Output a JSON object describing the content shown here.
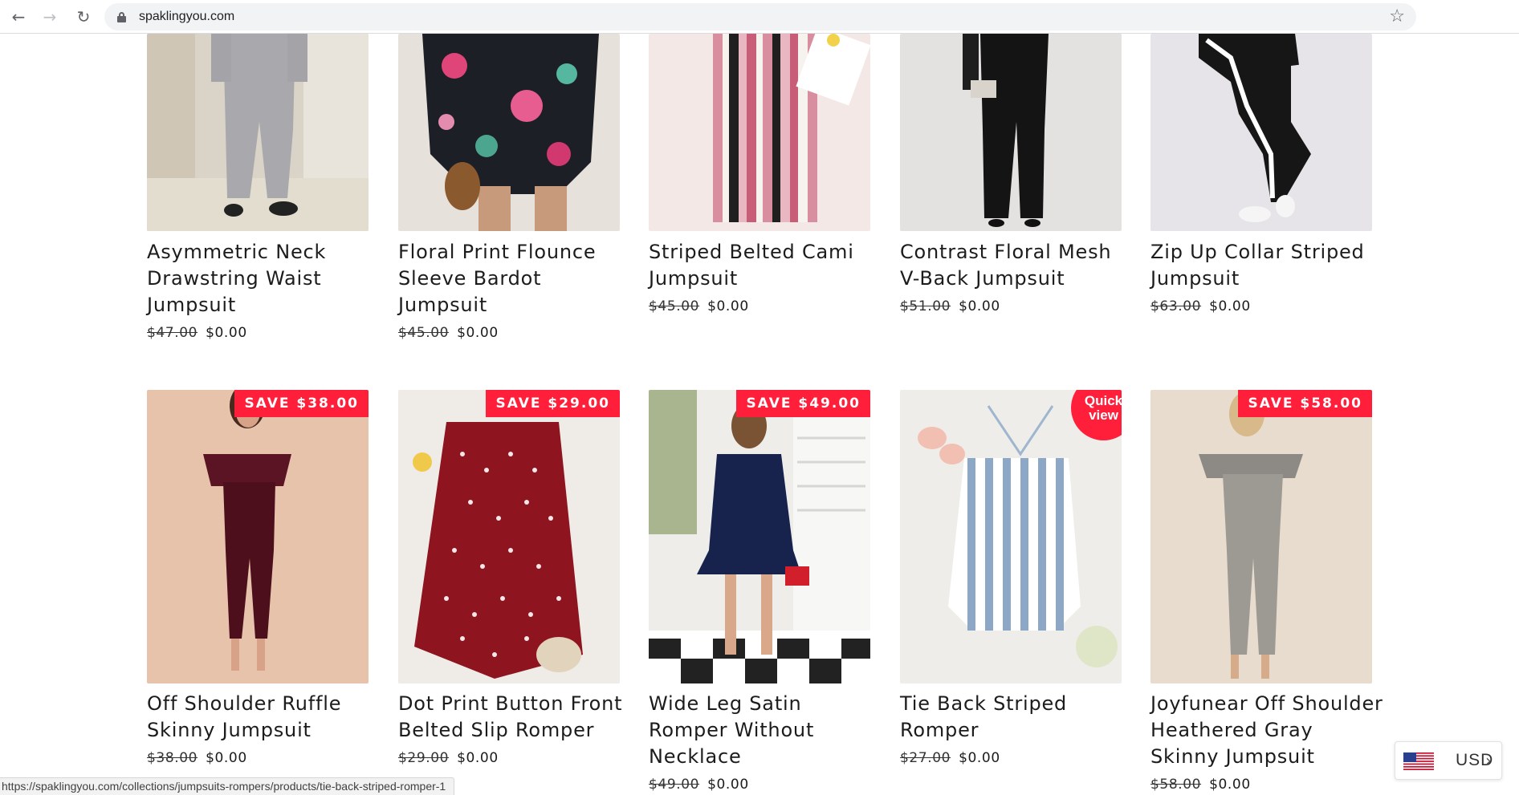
{
  "browser": {
    "url": "spaklingyou.com",
    "status_url": "https://spaklingyou.com/collections/jumpsuits-rompers/products/tie-back-striped-romper-1"
  },
  "icons": {
    "back": "back-arrow-icon",
    "forward": "forward-arrow-icon",
    "reload": "reload-icon",
    "lock": "lock-icon",
    "bookmark": "star-icon",
    "flag": "us-flag-icon",
    "chevron": "chevron-right-icon"
  },
  "colors": {
    "badge": "#ff1f3a",
    "text": "#1c1c1c"
  },
  "products_row1": [
    {
      "title": "Asymmetric Neck Drawstring Waist Jumpsuit",
      "old_price": "$47.00",
      "price": "$0.00"
    },
    {
      "title": "Floral Print Flounce Sleeve Bardot Jumpsuit",
      "old_price": "$45.00",
      "price": "$0.00"
    },
    {
      "title": "Striped Belted Cami Jumpsuit",
      "old_price": "$45.00",
      "price": "$0.00"
    },
    {
      "title": "Contrast Floral Mesh V-Back Jumpsuit",
      "old_price": "$51.00",
      "price": "$0.00"
    },
    {
      "title": "Zip Up Collar Striped Jumpsuit",
      "old_price": "$63.00",
      "price": "$0.00"
    }
  ],
  "products_row2": [
    {
      "title": "Off Shoulder Ruffle Skinny Jumpsuit",
      "old_price": "$38.00",
      "price": "$0.00",
      "badge": "SAVE $38.00"
    },
    {
      "title": "Dot Print Button Front Belted Slip Romper",
      "old_price": "$29.00",
      "price": "$0.00",
      "badge": "SAVE $29.00"
    },
    {
      "title": "Wide Leg Satin Romper Without Necklace",
      "old_price": "$49.00",
      "price": "$0.00",
      "badge": "SAVE $49.00"
    },
    {
      "title": "Tie Back Striped Romper",
      "old_price": "$27.00",
      "price": "$0.00",
      "quick_view": "Quick view"
    },
    {
      "title": "Joyfunear Off Shoulder Heathered Gray Skinny Jumpsuit",
      "old_price": "$58.00",
      "price": "$0.00",
      "badge": "SAVE $58.00"
    }
  ],
  "currency": {
    "code": "USD"
  }
}
